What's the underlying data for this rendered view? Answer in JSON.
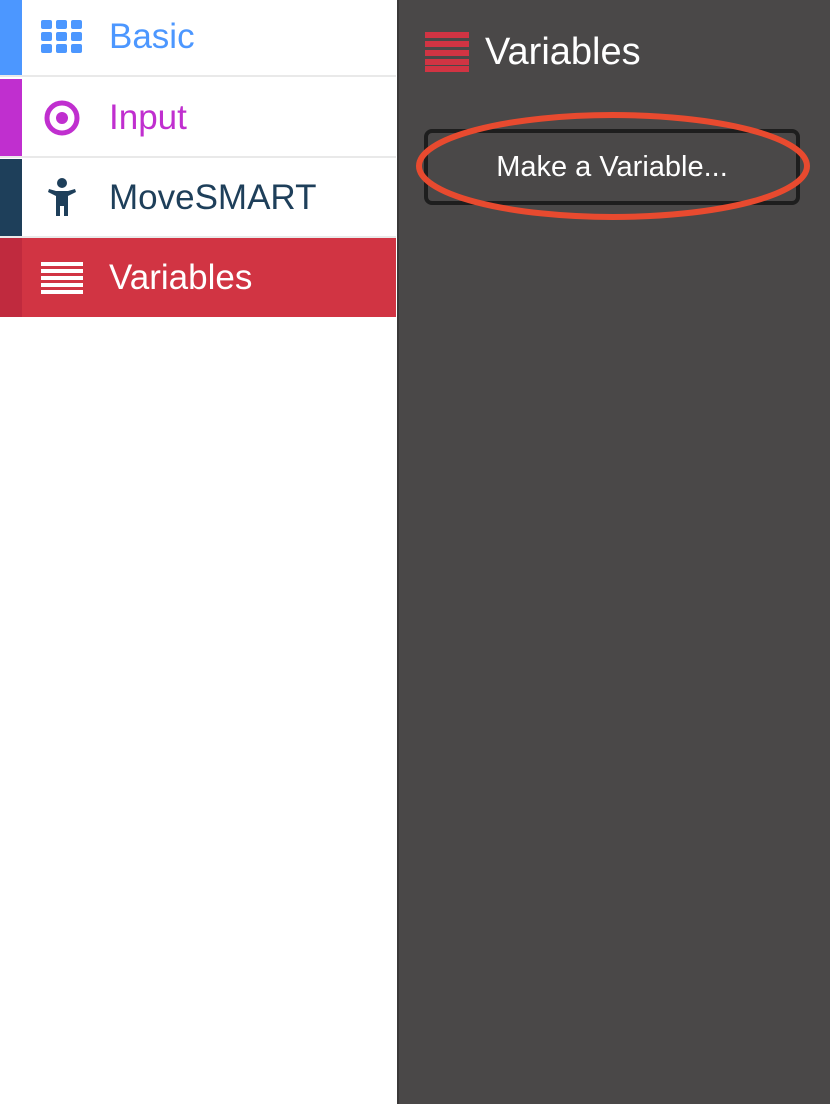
{
  "toolbox": {
    "categories": [
      {
        "label": "Basic",
        "icon": "grid-icon",
        "color": "#4c97ff",
        "stripe": "#4c97ff"
      },
      {
        "label": "Input",
        "icon": "target-icon",
        "color": "#c02fcf",
        "stripe": "#c02fcf"
      },
      {
        "label": "MoveSMART",
        "icon": "person-icon",
        "color": "#1e3f5a",
        "stripe": "#1e3f5a"
      },
      {
        "label": "Variables",
        "icon": "list-icon",
        "color": "#ffffff",
        "stripe": "#c02a3e",
        "selected": true,
        "background": "#d13443"
      }
    ]
  },
  "flyout": {
    "title": "Variables",
    "title_icon": "list-icon",
    "make_variable_label": "Make a Variable...",
    "background": "#4a4848",
    "highlight_color": "#e84a2f"
  }
}
